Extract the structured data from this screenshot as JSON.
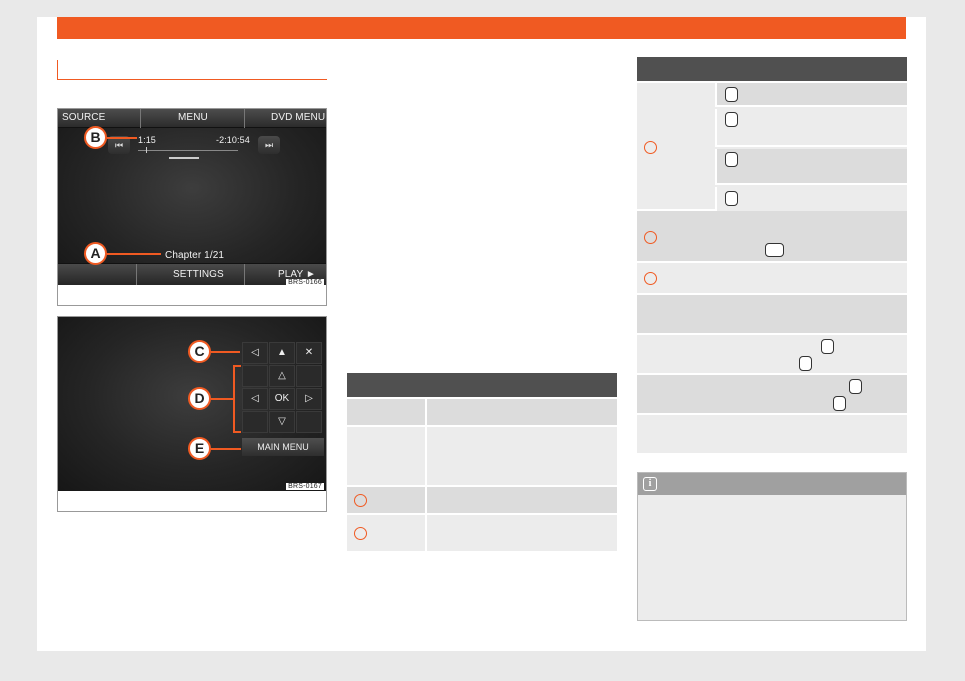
{
  "figure1": {
    "screen": {
      "top_buttons": [
        "SOURCE",
        "MENU",
        "DVD MENU"
      ],
      "elapsed_time": "1:15",
      "remaining_time": "-2:10:54",
      "chapter": "Chapter 1/21",
      "bottom_buttons": [
        "SETTINGS",
        "PLAY ►"
      ],
      "skip_back_symbol": "⏮",
      "skip_forward_symbol": "⏭"
    },
    "callouts": [
      "B",
      "A"
    ],
    "code": "BRS-0166"
  },
  "figure2": {
    "pad": {
      "row1": [
        "◁",
        "▲",
        "✕"
      ],
      "row2": [
        "△"
      ],
      "row3": [
        "◁",
        "OK",
        "▷"
      ],
      "row4": [
        "▽"
      ],
      "main_menu": "MAIN MENU"
    },
    "callouts": [
      "C",
      "D",
      "E"
    ],
    "code": "BRS-0167"
  },
  "note": {
    "icon": "i"
  },
  "colors": {
    "accent": "#f05a22",
    "table_header": "#505050",
    "row_dark": "#dcdcdc",
    "row_light": "#ececec"
  }
}
